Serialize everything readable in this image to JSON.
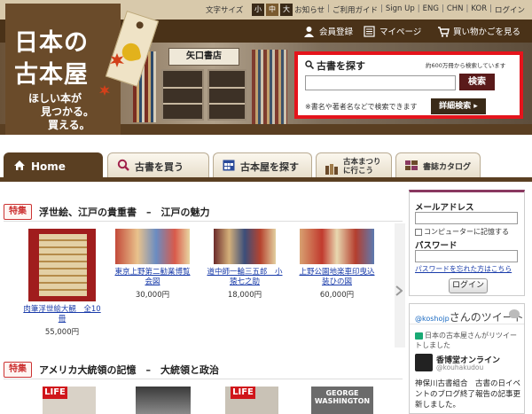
{
  "topbar": {
    "font_size_label": "文字サイズ",
    "font_sizes": [
      "小",
      "中",
      "大"
    ],
    "links": [
      "お知らせ",
      "ご利用ガイド",
      "Sign Up",
      "ENG",
      "CHN",
      "KOR",
      "ログイン"
    ]
  },
  "account_nav": {
    "register": "会員登録",
    "mypage": "マイページ",
    "cart": "買い物かごを見る"
  },
  "logo": {
    "line1": "日本の",
    "line2": "古本屋",
    "tagline": [
      "ほしい本が",
      "見つかる。",
      "買える。"
    ]
  },
  "storefront_sign": "矢口書店",
  "search": {
    "title": "古書を探す",
    "count_note": "約600万冊から検索しています",
    "placeholder": "",
    "button": "検索",
    "hint": "※書名や著者名などで検索できます",
    "advanced_button": "詳細検索"
  },
  "tabs": [
    {
      "label": "Home"
    },
    {
      "label": "古書を買う"
    },
    {
      "label": "古本屋を探す"
    },
    {
      "label": "古本まつり\nに行こう"
    },
    {
      "label": "書誌カタログ"
    }
  ],
  "features": [
    {
      "badge": "特集",
      "title": "浮世絵、江戸の貴重書　–　江戸の魅力",
      "books": [
        {
          "title": "肉筆浮世絵大観　全10冊",
          "price": "55,000円"
        },
        {
          "title": "東京上野第二勧業博覧会図",
          "price": "30,000円"
        },
        {
          "title": "道中師一輪三五郎　小猿七之助",
          "price": "18,000円"
        },
        {
          "title": "上野公園地楽車印曳込装ひの図",
          "price": "60,000円"
        }
      ]
    },
    {
      "badge": "特集",
      "title": "アメリカ大統領の記憶　–　大統領と政治",
      "books": [
        {
          "cover_text": "LIFE"
        },
        {
          "cover_text": ""
        },
        {
          "cover_text": "LIFE"
        },
        {
          "cover_text": "GEORGE WASHINGTON"
        }
      ]
    }
  ],
  "login": {
    "email_label": "メールアドレス",
    "remember_label": "コンピューターに記憶する",
    "password_label": "パスワード",
    "forgot_link": "パスワードを忘れた方はこちら",
    "button": "ログイン"
  },
  "twitter": {
    "handle": "@koshojp",
    "heading_suffix": "さんのツイート",
    "retweet_note": "日本の古本屋さんがリツイートしました",
    "user_name": "香博堂オンライン",
    "user_handle": "@kouhakudou",
    "text": "神保川古書組合　古書の日イベントのブログ終了報告の記事更新しました。"
  },
  "colors": {
    "brand_brown": "#5a3f22",
    "search_border": "#e5141c",
    "link_blue": "#1a3caa",
    "badge_red": "#cc3333"
  }
}
